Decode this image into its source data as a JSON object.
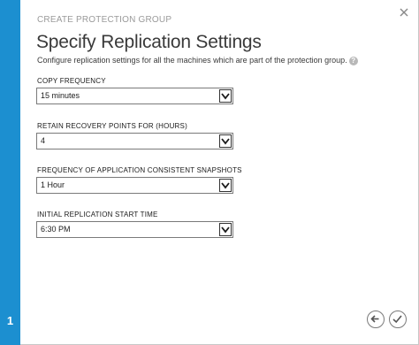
{
  "wizard": {
    "eyebrow": "CREATE PROTECTION GROUP",
    "title": "Specify Replication Settings",
    "subtitle": "Configure replication settings for all the machines which are part of the protection group.",
    "step": "1"
  },
  "fields": [
    {
      "label": "COPY FREQUENCY",
      "value": "15 minutes"
    },
    {
      "label": "RETAIN RECOVERY POINTS FOR (HOURS)",
      "value": "4"
    },
    {
      "label": "FREQUENCY OF APPLICATION CONSISTENT SNAPSHOTS",
      "value": "1 Hour"
    },
    {
      "label": "INITIAL REPLICATION START TIME",
      "value": "6:30 PM"
    }
  ],
  "icons": {
    "close": "close-icon",
    "help": "help-icon",
    "back": "back-arrow-icon",
    "complete": "checkmark-icon",
    "dropdown": "chevron-down-icon"
  },
  "colors": {
    "rail": "#1c8fd0",
    "text": "#3a3a3a"
  }
}
